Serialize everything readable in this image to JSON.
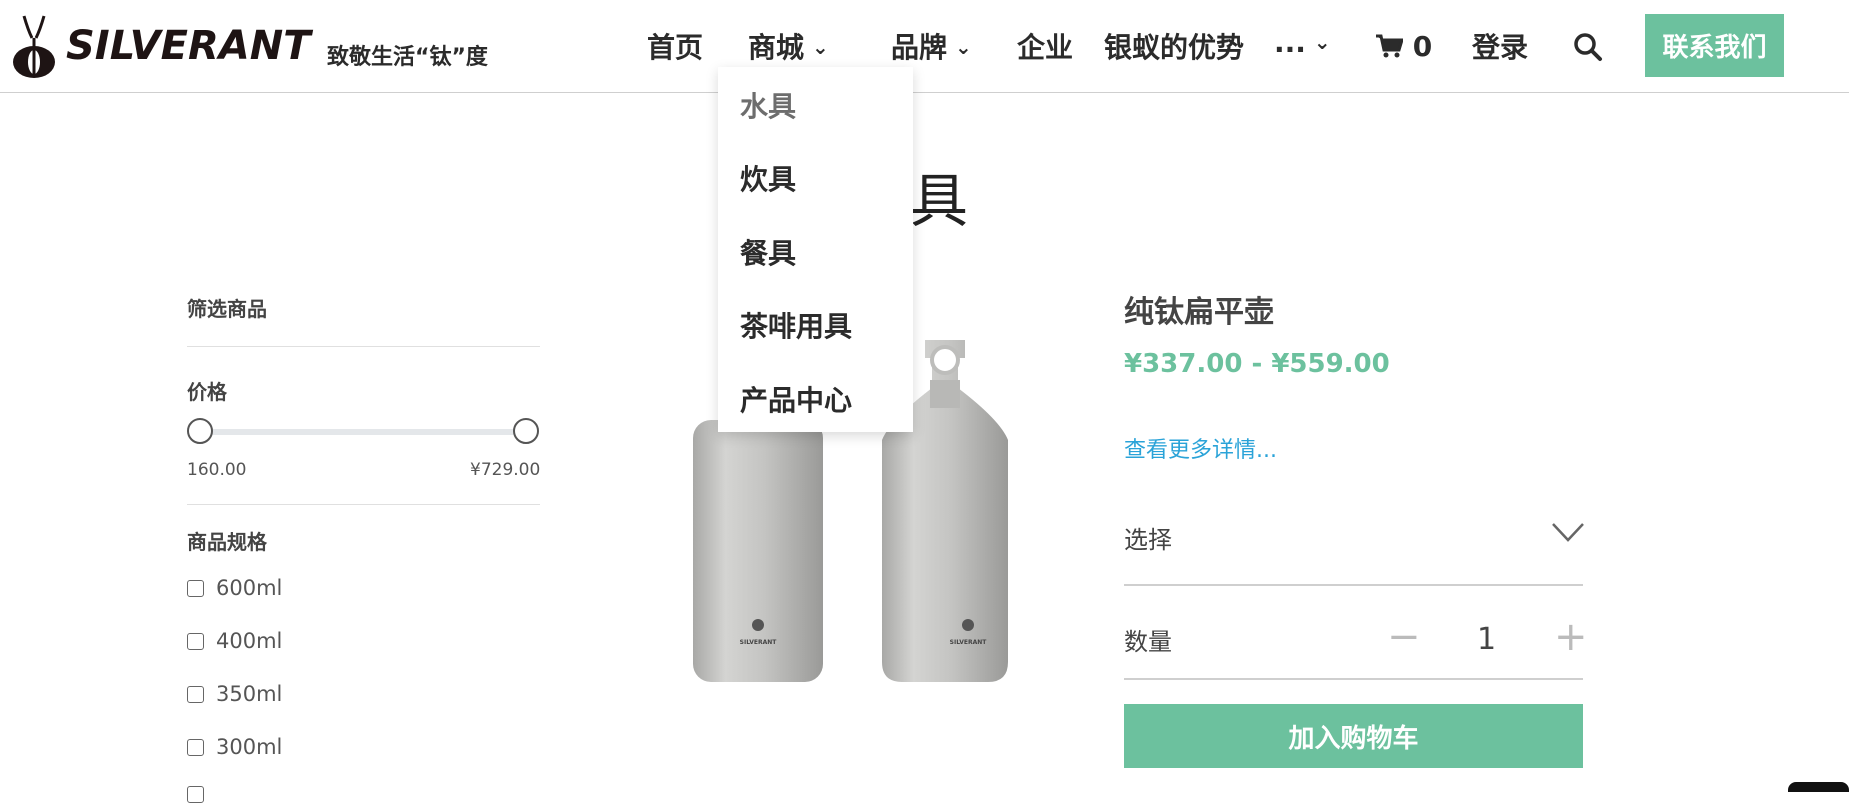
{
  "header": {
    "brand": "SILVERANT",
    "tagline": "致敬生活“钛”度",
    "nav": {
      "home": "首页",
      "shop": "商城",
      "brand_label": "品牌",
      "enterprise": "企业",
      "advantage": "银蚁的优势",
      "more": "..."
    },
    "cart_count": "0",
    "login": "登录",
    "contact": "联系我们"
  },
  "dropdown": {
    "items": [
      "水具",
      "炊具",
      "餐具",
      "茶啡用具",
      "产品中心"
    ]
  },
  "page": {
    "title": "具"
  },
  "sidebar": {
    "filter_title": "筛选商品",
    "price_title": "价格",
    "price_min": "160.00",
    "price_max": "¥729.00",
    "spec_title": "商品规格",
    "specs": [
      "600ml",
      "400ml",
      "350ml",
      "300ml"
    ]
  },
  "product": {
    "name": "纯钛扁平壶",
    "price": "¥337.00 - ¥559.00",
    "more_link": "查看更多详情...",
    "select_label": "选择",
    "qty_label": "数量",
    "qty_minus": "−",
    "qty_value": "1",
    "qty_plus": "+",
    "add_to_cart": "加入购物车",
    "bottle_brand": "SILVERANT"
  },
  "colors": {
    "accent": "#6cc19e",
    "link": "#2aa3d8"
  },
  "icons": [
    "cart-icon",
    "search-icon",
    "chevron-down-icon",
    "ant-logo-icon"
  ]
}
